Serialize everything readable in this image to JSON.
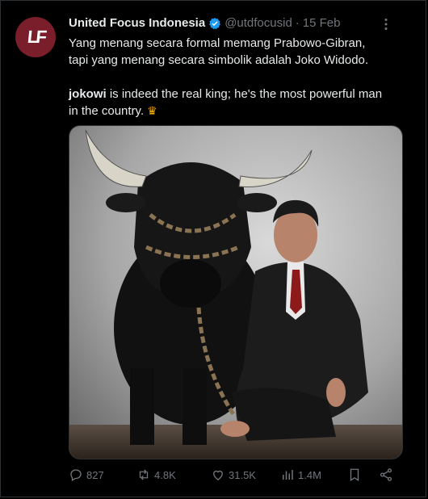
{
  "tweet": {
    "avatar_text": "LF",
    "display_name": "United Focus Indonesia",
    "handle": "@utdfocusid",
    "separator": "·",
    "date": "15 Feb",
    "line1": "Yang menang secara formal memang Prabowo-Gibran,",
    "line2": "tapi yang menang secara simbolik adalah Joko Widodo.",
    "bold_word": "jokowi",
    "line3_rest": " is indeed the real king; he's the most powerful man",
    "line4": "in the country.",
    "crown_icon": "crown-icon"
  },
  "actions": {
    "replies": "827",
    "reposts": "4.8K",
    "likes": "31.5K",
    "views": "1.4M"
  },
  "colors": {
    "accent": "#1d9bf0",
    "muted": "#71767b",
    "text": "#e7e9ea",
    "avatar_bg": "#7a1e2c"
  }
}
